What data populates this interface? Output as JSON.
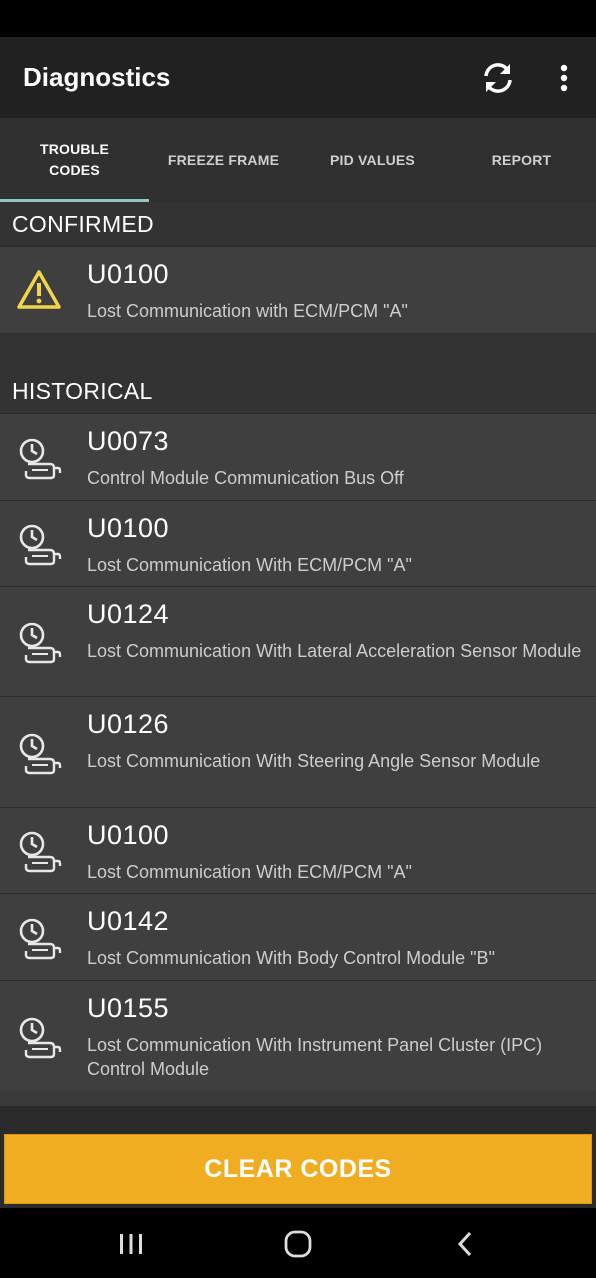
{
  "app": {
    "title": "Diagnostics"
  },
  "toolbar": {
    "refresh_icon": "refresh-icon",
    "overflow_icon": "more-vert-icon"
  },
  "tabs": [
    {
      "label": "TROUBLE\nCODES",
      "active": true
    },
    {
      "label": "FREEZE FRAME",
      "active": false
    },
    {
      "label": "PID VALUES",
      "active": false
    },
    {
      "label": "REPORT",
      "active": false
    }
  ],
  "confirmed": {
    "header": "CONFIRMED",
    "items": [
      {
        "code": "U0100",
        "description": "Lost Communication with ECM/PCM \"A\"",
        "icon": "warning-icon"
      }
    ]
  },
  "historical": {
    "header": "HISTORICAL",
    "items": [
      {
        "code": "U0073",
        "description": "Control Module Communication Bus Off",
        "icon": "history-icon"
      },
      {
        "code": "U0100",
        "description": "Lost Communication With ECM/PCM \"A\"",
        "icon": "history-icon"
      },
      {
        "code": "U0124",
        "description": "Lost Communication With Lateral Acceleration Sensor Module",
        "icon": "history-icon"
      },
      {
        "code": "U0126",
        "description": "Lost Communication With Steering Angle Sensor Module",
        "icon": "history-icon"
      },
      {
        "code": "U0100",
        "description": "Lost Communication With ECM/PCM \"A\"",
        "icon": "history-icon"
      },
      {
        "code": "U0142",
        "description": "Lost Communication With Body Control Module \"B\"",
        "icon": "history-icon"
      },
      {
        "code": "U0155",
        "description": "Lost Communication With Instrument Panel Cluster (IPC) Control Module",
        "icon": "history-icon"
      }
    ]
  },
  "actions": {
    "clear_label": "CLEAR CODES"
  },
  "colors": {
    "accent": "#f0ad21",
    "tab_indicator": "#8fc7c6",
    "warning": "#f2d54a"
  },
  "navigation": {
    "recents_icon": "recents-icon",
    "home_icon": "home-icon",
    "back_icon": "back-icon"
  }
}
